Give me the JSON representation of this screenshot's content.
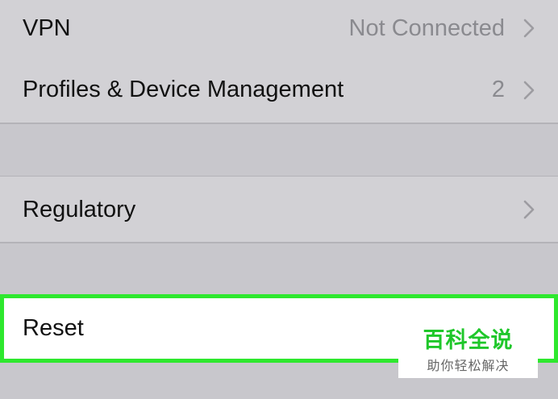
{
  "settings": {
    "rows": [
      {
        "label": "VPN",
        "value": "Not Connected"
      },
      {
        "label": "Profiles & Device Management",
        "value": "2"
      },
      {
        "label": "Regulatory"
      },
      {
        "label": "Reset"
      }
    ]
  },
  "watermark": {
    "title": "百科全说",
    "subtitle": "助你轻松解决"
  },
  "colors": {
    "background": "#c8c7cc",
    "row": "#d2d1d5",
    "highlight_border": "#2ee82e",
    "value_text": "#8a8a8f",
    "watermark_green": "#1fc72a"
  },
  "icons": {
    "disclosure": "chevron-right-icon"
  }
}
